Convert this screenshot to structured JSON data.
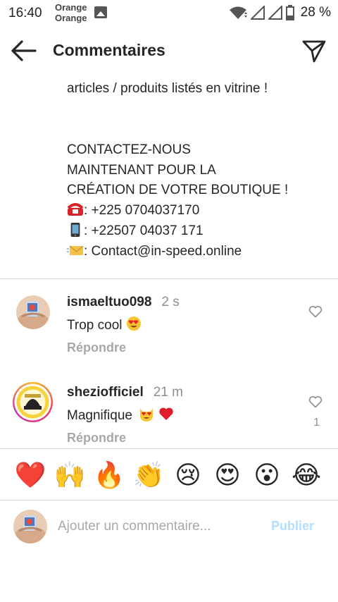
{
  "status_bar": {
    "time": "16:40",
    "carrier_line1": "Orange",
    "carrier_line2": "Orange",
    "battery": "28 %"
  },
  "header": {
    "title": "Commentaires"
  },
  "caption": {
    "line1": "articles / produits listés en vitrine !",
    "line2": "CONTACTEZ-NOUS",
    "line3": "MAINTENANT POUR LA",
    "line4": "CRÉATION DE VOTRE BOUTIQUE !",
    "phone": ": +225 0704037170",
    "mobile": ": +22507 04037 171",
    "email": ": Contact@in-speed.online"
  },
  "comments": [
    {
      "username": "ismaeltuo098",
      "time": "2 s",
      "text": "Trop cool",
      "reply": "Répondre",
      "likes": ""
    },
    {
      "username": "sheziofficiel",
      "time": "21 m",
      "text": "Magnifique",
      "reply": "Répondre",
      "likes": "1"
    }
  ],
  "emoji_bar": [
    "❤️",
    "🙌",
    "🔥",
    "👏",
    "😢",
    "😍",
    "😮",
    "😂"
  ],
  "input": {
    "placeholder": "Ajouter un commentaire...",
    "value": "",
    "publish": "Publier"
  },
  "colors": {
    "text": "#262626",
    "secondary": "#8e8e8e",
    "reply": "#a8a8a8",
    "publish_disabled": "#b2dffc",
    "divider": "#dbdbdb",
    "story_ring": "#c837ab"
  }
}
